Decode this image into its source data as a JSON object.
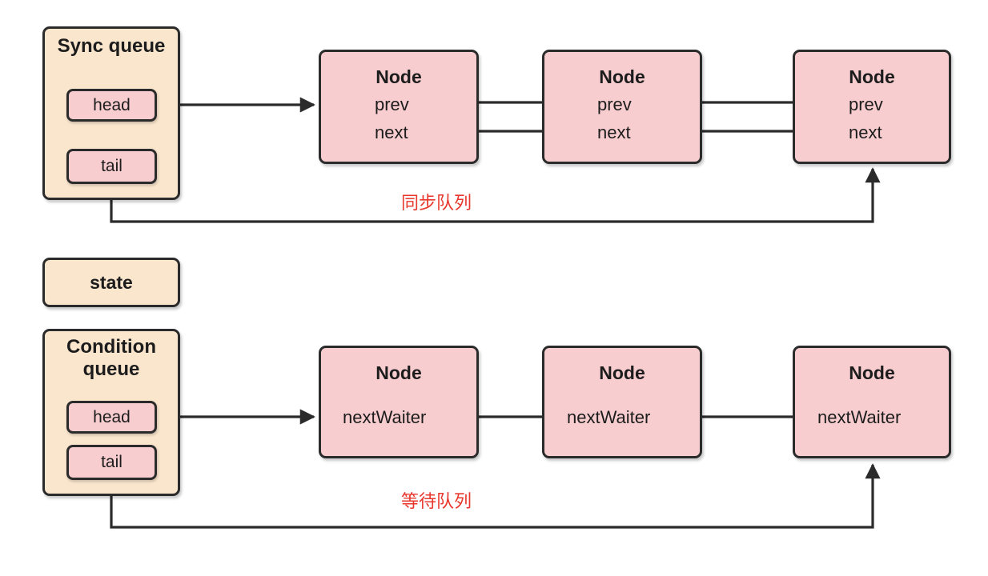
{
  "diagram": {
    "title_hidden": "",
    "colors": {
      "queue_fill": "#fae5cd",
      "node_fill": "#f8cdd0",
      "stroke": "#2b2b2b",
      "annotation_red": "#e8372c",
      "background": "#ffffff"
    },
    "sync_section": {
      "queue": {
        "title": "Sync queue",
        "slots": [
          {
            "label": "head"
          },
          {
            "label": "tail"
          }
        ]
      },
      "nodes": [
        {
          "title": "Node",
          "fields": [
            "prev",
            "next"
          ]
        },
        {
          "title": "Node",
          "fields": [
            "prev",
            "next"
          ]
        },
        {
          "title": "Node",
          "fields": [
            "prev",
            "next"
          ]
        }
      ],
      "annotation": "同步队列"
    },
    "state": {
      "label": "state"
    },
    "condition_section": {
      "queue": {
        "title_line1": "Condition",
        "title_line2": "queue",
        "slots": [
          {
            "label": "head"
          },
          {
            "label": "tail"
          }
        ]
      },
      "nodes": [
        {
          "title": "Node",
          "fields": [
            "nextWaiter"
          ]
        },
        {
          "title": "Node",
          "fields": [
            "nextWaiter"
          ]
        },
        {
          "title": "Node",
          "fields": [
            "nextWaiter"
          ]
        }
      ],
      "annotation": "等待队列"
    }
  }
}
